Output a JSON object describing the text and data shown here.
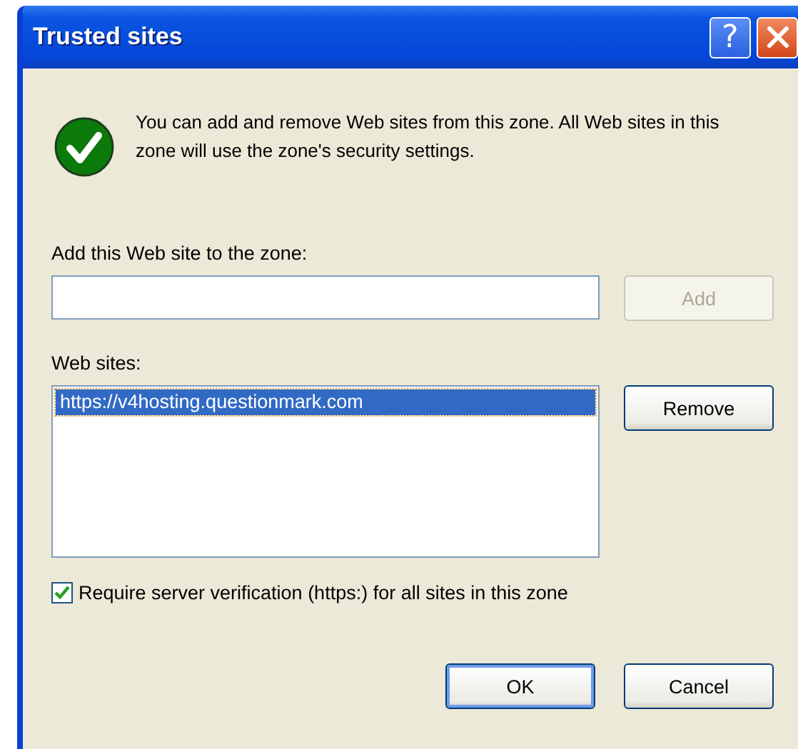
{
  "window": {
    "title": "Trusted sites",
    "help_button": "?"
  },
  "message": "You can add and remove Web sites from this zone. All Web sites in this zone will use the zone's security settings.",
  "add_field": {
    "label": "Add this Web site to the zone:"
  },
  "add_button": {
    "label": "Add",
    "disabled": true
  },
  "websites": {
    "label": "Web sites:",
    "items": [
      {
        "url": "https://v4hosting.questionmark.com",
        "selected": true
      }
    ]
  },
  "remove_button": {
    "label": "Remove",
    "disabled": false
  },
  "require_https": {
    "label": "Require server verification (https:) for all sites in this zone",
    "checked": true
  },
  "buttons": [
    {
      "label": "OK",
      "default": true
    },
    {
      "label": "Cancel",
      "default": false
    }
  ]
}
